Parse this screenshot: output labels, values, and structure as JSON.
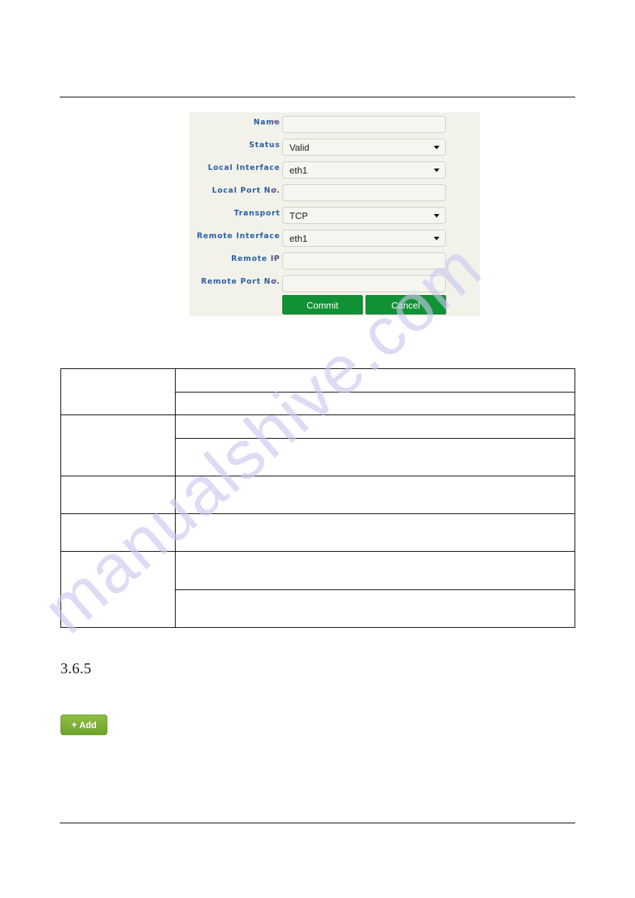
{
  "page": {
    "section_heading": "3.6.5",
    "header_rule": "horizontal-rule",
    "footer_rule": "horizontal-rule"
  },
  "watermark": {
    "text": "manualshive.com",
    "color": "#c9c8ef"
  },
  "form_panel": {
    "background": "#f2f2ea",
    "rows": [
      {
        "label": "Name",
        "required": true,
        "control": "text",
        "value": ""
      },
      {
        "label": "Status",
        "required": false,
        "control": "select",
        "value": "Valid"
      },
      {
        "label": "Local Interface",
        "required": false,
        "control": "select",
        "value": "eth1"
      },
      {
        "label": "Local Port No.",
        "required": true,
        "control": "text",
        "value": ""
      },
      {
        "label": "Transport",
        "required": false,
        "control": "select",
        "value": "TCP"
      },
      {
        "label": "Remote Interface",
        "required": false,
        "control": "select",
        "value": "eth1"
      },
      {
        "label": "Remote IP",
        "required": true,
        "control": "text",
        "value": ""
      },
      {
        "label": "Remote Port No.",
        "required": true,
        "control": "text",
        "value": ""
      }
    ],
    "required_marker": "*",
    "label_color": "#2b5fa8",
    "required_color": "#d9453c",
    "buttons": {
      "commit_label": "Commit",
      "cancel_label": "Cancel",
      "color": "#119335"
    }
  },
  "description_table": {
    "rows": [
      {
        "key": "",
        "values": [
          "",
          ""
        ]
      },
      {
        "key": "",
        "values": [
          "",
          ""
        ]
      },
      {
        "key": "",
        "values": [
          ""
        ]
      },
      {
        "key": "",
        "values": [
          ""
        ]
      },
      {
        "key": "",
        "values": [
          "",
          ""
        ]
      }
    ]
  },
  "add_button": {
    "plus": "+",
    "label": "Add",
    "color": "#7cb036"
  }
}
